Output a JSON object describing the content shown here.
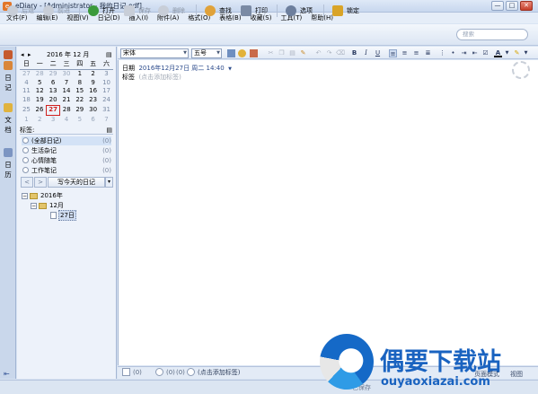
{
  "window": {
    "title": "eDiary - [Administrator - 我的日记.edf]",
    "minimize": "—",
    "maximize": "□",
    "close": "✕"
  },
  "menu": [
    "文件(F)",
    "编辑(E)",
    "视图(V)",
    "日记(D)",
    "插入(I)",
    "附件(A)",
    "格式(O)",
    "表格(B)",
    "收藏(S)",
    "工具(T)",
    "帮助(H)"
  ],
  "toolbar": {
    "back": "后退",
    "forward": "前进",
    "open": "打开",
    "save": "保存",
    "delete": "删除",
    "find": "查找",
    "print": "打印",
    "options": "选项",
    "lock": "锁定",
    "search_placeholder": "搜索"
  },
  "side_tabs": {
    "diary": "日记",
    "docs": "文档",
    "calendar": "日历"
  },
  "calendar": {
    "header": "2016 年 12 月",
    "prev": "◂",
    "next": "▸",
    "weekdays": [
      "日",
      "一",
      "二",
      "三",
      "四",
      "五",
      "六"
    ],
    "weeks": [
      [
        "27",
        "28",
        "29",
        "30",
        "1",
        "2",
        "3"
      ],
      [
        "4",
        "5",
        "6",
        "7",
        "8",
        "9",
        "10"
      ],
      [
        "11",
        "12",
        "13",
        "14",
        "15",
        "16",
        "17"
      ],
      [
        "18",
        "19",
        "20",
        "21",
        "22",
        "23",
        "24"
      ],
      [
        "25",
        "26",
        "27",
        "28",
        "29",
        "30",
        "31"
      ],
      [
        "1",
        "2",
        "3",
        "4",
        "5",
        "6",
        "7"
      ]
    ],
    "today": "27"
  },
  "tags": {
    "header": "标签:",
    "items": [
      {
        "label": "(全部日记)",
        "count": "(0)"
      },
      {
        "label": "生活杂记",
        "count": "(0)"
      },
      {
        "label": "心情随笔",
        "count": "(0)"
      },
      {
        "label": "工作笔记",
        "count": "(0)"
      }
    ]
  },
  "nav": {
    "prev": "<",
    "next": ">",
    "write_today": "写今天的日记",
    "dropdown": "▾"
  },
  "tree": {
    "year": "2016年",
    "month": "12月",
    "day": "27日"
  },
  "format": {
    "font": "宋体",
    "size": "五号",
    "bold": "B",
    "italic": "I",
    "underline": "U",
    "font_color": "A"
  },
  "entry": {
    "date_label": "日期",
    "date_value": "2016年12月27日  周二  14:40",
    "tag_label": "标签",
    "tag_placeholder": "(点击添加标签)"
  },
  "bottom": {
    "count1": "(0)",
    "count2": "(0)",
    "count3": "(0)",
    "add_tag": "(点击添加标签)"
  },
  "status": {
    "text": "已保存",
    "mode": "页面模式",
    "view": "视图"
  },
  "watermark": {
    "text": "偶要下载站",
    "url": "ouyaoxiazai.com"
  },
  "colors": {
    "accent": "#1a63c0",
    "today": "#d0201e"
  }
}
